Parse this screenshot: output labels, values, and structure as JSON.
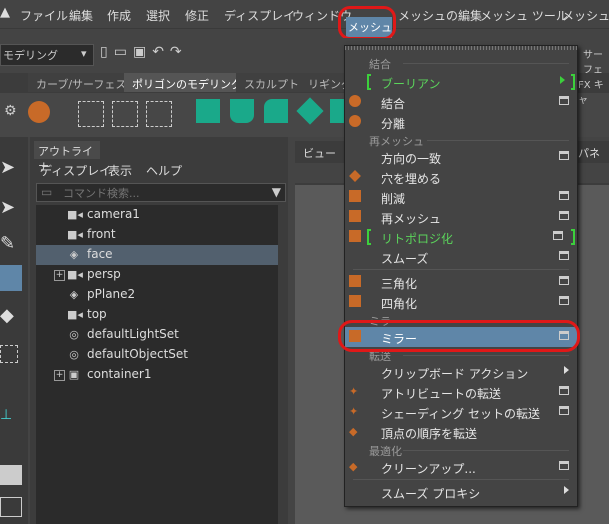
{
  "menubar": {
    "items": [
      "ファイル",
      "編集",
      "作成",
      "選択",
      "修正",
      "ディスプレイ",
      "ウィンドウ",
      "メッシュ",
      "メッシュの編集",
      "メッシュ ツール",
      "メッシュ表示"
    ]
  },
  "toolbar": {
    "mode": "モデリング",
    "right_tab": "サーフェス"
  },
  "shelf": {
    "tabs": [
      "カーブ/サーフェス",
      "ポリゴンのモデリング",
      "スカルプト",
      "リギング"
    ],
    "active_tab_index": 1
  },
  "outliner": {
    "tab": "アウトライナ",
    "menu": [
      "ディスプレイ",
      "表示",
      "ヘルプ"
    ],
    "search_placeholder": "コマンド検索...",
    "items": [
      {
        "label": "camera1",
        "icon": "camera-icon",
        "expandable": false,
        "selected": false
      },
      {
        "label": "front",
        "icon": "camera-icon",
        "expandable": false,
        "selected": false
      },
      {
        "label": "face",
        "icon": "mesh-icon",
        "expandable": false,
        "selected": true
      },
      {
        "label": "persp",
        "icon": "camera-icon",
        "expandable": true,
        "selected": false
      },
      {
        "label": "pPlane2",
        "icon": "mesh-icon",
        "expandable": false,
        "selected": false
      },
      {
        "label": "top",
        "icon": "camera-icon",
        "expandable": false,
        "selected": false
      },
      {
        "label": "defaultLightSet",
        "icon": "set-icon",
        "expandable": false,
        "selected": false
      },
      {
        "label": "defaultObjectSet",
        "icon": "set-icon",
        "expandable": false,
        "selected": false
      },
      {
        "label": "container1",
        "icon": "container-icon",
        "expandable": true,
        "selected": false
      }
    ]
  },
  "viewport": {
    "label": "ビュー",
    "panel_label": "パネル",
    "fx_label": "FX キャ"
  },
  "mesh_menu": {
    "sections": {
      "combine": "結合",
      "remesh": "再メッシュ",
      "mirror": "ミラー",
      "transfer": "転送",
      "optimize": "最適化"
    },
    "items": {
      "boolean": "ブーリアン",
      "combine": "結合",
      "separate": "分離",
      "conform": "方向の一致",
      "fill_hole": "穴を埋める",
      "reduce": "削減",
      "remesh": "再メッシュ",
      "retopologize": "リトポロジ化",
      "smooth": "スムーズ",
      "triangulate": "三角化",
      "quadrangulate": "四角化",
      "mirror": "ミラー",
      "clipboard": "クリップボード アクション",
      "transfer_attributes": "アトリビュートの転送",
      "transfer_shading": "シェーディング セットの転送",
      "transfer_vertex_order": "頂点の順序を転送",
      "cleanup": "クリーンアップ...",
      "smooth_proxy": "スムーズ プロキシ"
    }
  },
  "colors": {
    "highlight": "#5f86a8",
    "annotation": "#e01818",
    "accent_green": "#3cd03c"
  }
}
